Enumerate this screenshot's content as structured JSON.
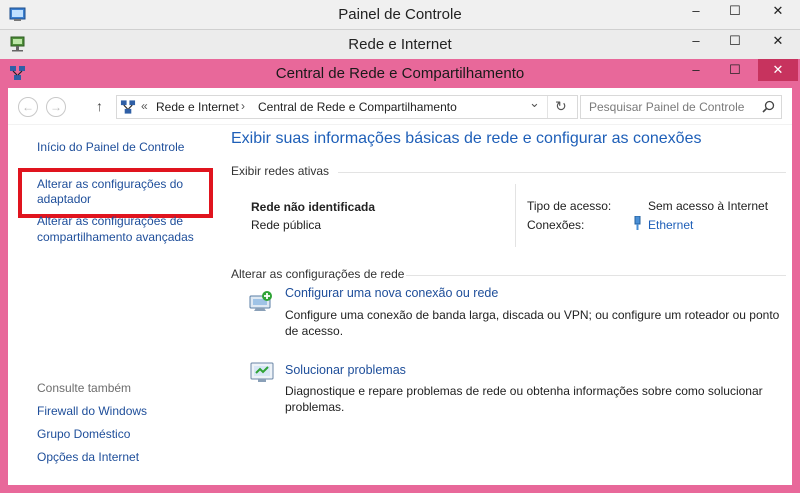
{
  "windows": {
    "back1_title": "Painel de Controle",
    "back2_title": "Rede e Internet",
    "front_title": "Central de Rede e Compartilhamento",
    "controls": {
      "minimize": "–",
      "maximize": "☐",
      "close": "✕"
    }
  },
  "nav": {
    "back_glyph": "←",
    "forward_glyph": "→",
    "up_glyph": "↑",
    "breadcrumb_sep": "«",
    "breadcrumb": [
      "Rede e Internet",
      "Central de Rede e Compartilhamento"
    ],
    "crumb_arrow": "›",
    "dropdown_glyph": "⌄",
    "refresh_glyph": "↻",
    "search_placeholder": "Pesquisar Painel de Controle"
  },
  "sidebar": {
    "home": "Início do Painel de Controle",
    "adapter_line1": "Alterar as configurações do",
    "adapter_line2": "adaptador",
    "sharing_line1": "Alterar as configurações de",
    "sharing_line2": "compartilhamento avançadas",
    "see_also": "Consulte também",
    "see_also_items": [
      "Firewall do Windows",
      "Grupo Doméstico",
      "Opções da Internet"
    ]
  },
  "main": {
    "heading": "Exibir suas informações básicas de rede e configurar as conexões",
    "active_networks_label": "Exibir redes ativas",
    "network_name": "Rede não identificada",
    "network_type": "Rede pública",
    "access_type_label": "Tipo de acesso:",
    "access_type_value": "Sem acesso à Internet",
    "connections_label": "Conexões:",
    "connections_value": "Ethernet",
    "change_settings_label": "Alterar as configurações de rede",
    "task1_title": "Configurar uma nova conexão ou rede",
    "task1_desc1": "Configure uma conexão de banda larga, discada ou VPN; ou configure um roteador ou ponto",
    "task1_desc2": "de acesso.",
    "task2_title": "Solucionar problemas",
    "task2_desc1": "Diagnostique e repare problemas de rede ou obtenha informações sobre como solucionar",
    "task2_desc2": "problemas."
  },
  "colors": {
    "active_frame": "#e8689a",
    "link": "#1e4e9a",
    "heading": "#1e5fb8",
    "highlight": "#e0141e"
  }
}
